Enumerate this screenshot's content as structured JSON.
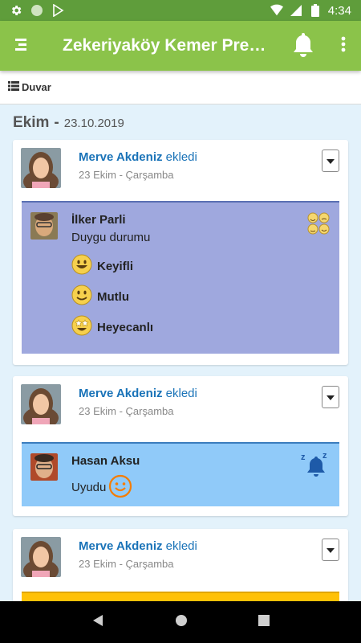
{
  "status_bar": {
    "time": "4:34"
  },
  "app_bar": {
    "title": "Zekeriyaköy Kemer Pres..."
  },
  "sub_header": {
    "label": "Duvar"
  },
  "date_heading": {
    "month": "Ekim",
    "separator": "-",
    "date": "23.10.2019"
  },
  "posts": [
    {
      "author": "Merve Akdeniz",
      "action": "ekledi",
      "date": "23 Ekim - Çarşamba",
      "child": "İlker Parli",
      "subtitle": "Duygu durumu",
      "moods": [
        "Keyifli",
        "Mutlu",
        "Heyecanlı"
      ]
    },
    {
      "author": "Merve Akdeniz",
      "action": "ekledi",
      "date": "23 Ekim - Çarşamba",
      "child": "Hasan Aksu",
      "subtitle": "Uyudu"
    },
    {
      "author": "Merve Akdeniz",
      "action": "ekledi",
      "date": "23 Ekim - Çarşamba"
    }
  ],
  "colors": {
    "status_bar": "#5f9d3b",
    "app_bar": "#8bc34a",
    "author_link": "#1a73b8",
    "mood_panel": "#9fa8de",
    "sleep_panel": "#90caf9",
    "third_panel": "#ffc107"
  },
  "icons": [
    "settings-icon",
    "circle-icon",
    "play-store-icon",
    "wifi-icon",
    "signal-icon",
    "battery-icon",
    "menu-icon",
    "bell-icon",
    "more-vert-icon",
    "list-icon",
    "dropdown-icon",
    "mood-icon",
    "smiley-icon",
    "star-eyes-icon",
    "sleep-bell-icon",
    "back-icon",
    "home-icon",
    "recents-icon"
  ]
}
